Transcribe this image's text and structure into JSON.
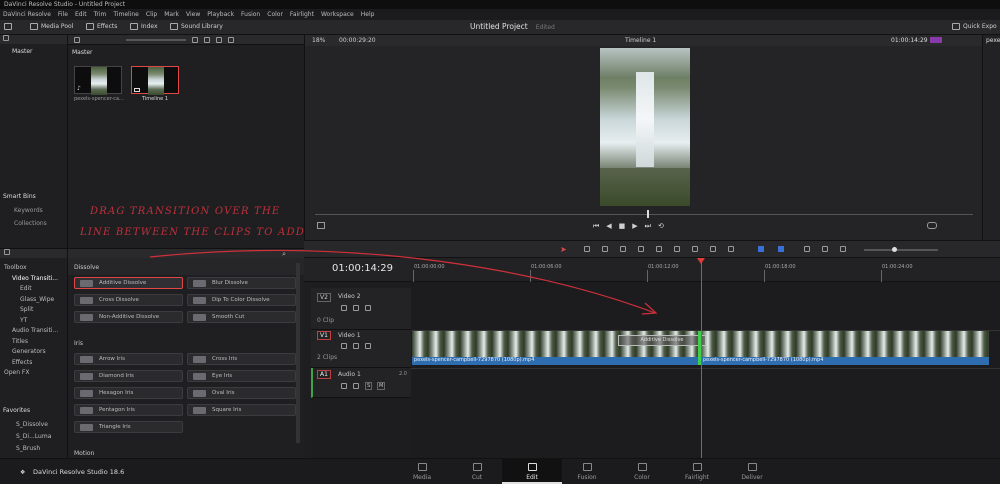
{
  "window": {
    "title": "DaVinci Resolve Studio - Untitled Project"
  },
  "menu": [
    "DaVinci Resolve",
    "File",
    "Edit",
    "Trim",
    "Timeline",
    "Clip",
    "Mark",
    "View",
    "Playback",
    "Fusion",
    "Color",
    "Fairlight",
    "Workspace",
    "Help"
  ],
  "toolbar": {
    "media_pool": "Media Pool",
    "effects": "Effects",
    "index": "Index",
    "sound_library": "Sound Library",
    "project_title": "Untitled Project",
    "edited": "Edited",
    "quick_export": "Quick Expo"
  },
  "media_pool": {
    "bin_header": "Master",
    "bin_root": "Master",
    "clips": [
      {
        "name": "pexels-spencer-ca..."
      },
      {
        "name": "Timeline 1"
      }
    ],
    "smart_bins": {
      "title": "Smart Bins",
      "items": [
        "Keywords",
        "Collections"
      ]
    }
  },
  "viewer": {
    "zoom": "18%",
    "source_tc": "00:00:29:20",
    "timeline_name": "Timeline 1",
    "record_tc": "01:00:14:29"
  },
  "inspector": {
    "clip_name": "pexels"
  },
  "annotation": {
    "line1": "DRAG TRANSITION OVER THE",
    "line2": "LINE BETWEEN THE CLIPS TO ADD"
  },
  "effects_tree": {
    "items": [
      {
        "label": "Toolbox",
        "indent": 0
      },
      {
        "label": "Video Transiti...",
        "indent": 1
      },
      {
        "label": "Edit",
        "indent": 2
      },
      {
        "label": "Glass_Wipe",
        "indent": 2
      },
      {
        "label": "Split",
        "indent": 2
      },
      {
        "label": "YT",
        "indent": 2
      },
      {
        "label": "Audio Transiti...",
        "indent": 1
      },
      {
        "label": "Titles",
        "indent": 1
      },
      {
        "label": "Generators",
        "indent": 1
      },
      {
        "label": "Effects",
        "indent": 1
      },
      {
        "label": "Open FX",
        "indent": 0
      }
    ],
    "favorites_title": "Favorites",
    "favorites": [
      "S_Dissolve",
      "S_Di...Luma",
      "S_Brush"
    ]
  },
  "effects_library": {
    "dissolve_title": "Dissolve",
    "dissolve": [
      "Additive Dissolve",
      "Blur Dissolve",
      "Cross Dissolve",
      "Dip To Color Dissolve",
      "Non-Additive Dissolve",
      "Smooth Cut"
    ],
    "iris_title": "Iris",
    "iris": [
      "Arrow Iris",
      "Cross Iris",
      "Diamond Iris",
      "Eye Iris",
      "Hexagon Iris",
      "Oval Iris",
      "Pentagon Iris",
      "Square Iris",
      "Triangle Iris"
    ],
    "motion_title": "Motion"
  },
  "timeline": {
    "timecode": "01:00:14:29",
    "ruler": [
      "01:00:00:00",
      "01:00:06:00",
      "01:00:12:00",
      "01:00:18:00",
      "01:00:24:00"
    ],
    "tracks": {
      "v2": {
        "id": "V2",
        "name": "Video 2",
        "info": "0 Clip"
      },
      "v1": {
        "id": "V1",
        "name": "Video 1",
        "info": "2 Clips"
      },
      "a1": {
        "id": "A1",
        "name": "Audio 1",
        "level": "2.0",
        "solo": "S",
        "mute": "M"
      }
    },
    "clip1": "pexels-spencer-campbell-7297870 (1080p).mp4",
    "clip2": "pexels-spencer-campbell-7297870 (1080p).mp4",
    "transition_label": "Additive Dissolve"
  },
  "bottom": {
    "app_name": "DaVinci Resolve Studio 18.6",
    "pages": [
      "Media",
      "Cut",
      "Edit",
      "Fusion",
      "Color",
      "Fairlight",
      "Deliver"
    ],
    "active_page": "Edit"
  },
  "colors": {
    "accent_red": "#e04848",
    "clip_blue": "#2f6db1",
    "playhead": "#e03c3c"
  }
}
